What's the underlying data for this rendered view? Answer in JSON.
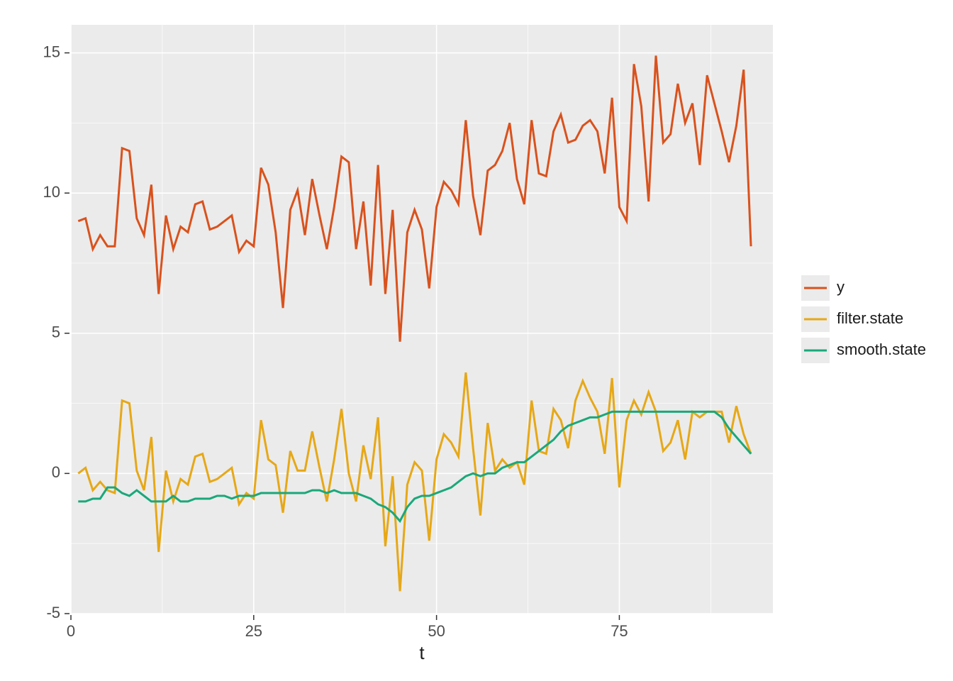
{
  "chart_data": {
    "type": "line",
    "xlabel": "t",
    "ylabel": "",
    "title": "",
    "xlim": [
      0,
      96
    ],
    "ylim": [
      -5,
      16
    ],
    "x_ticks": [
      0,
      25,
      50,
      75
    ],
    "y_ticks": [
      -5,
      0,
      5,
      10,
      15
    ],
    "grid": true,
    "legend_position": "right",
    "x": [
      1,
      2,
      3,
      4,
      5,
      6,
      7,
      8,
      9,
      10,
      11,
      12,
      13,
      14,
      15,
      16,
      17,
      18,
      19,
      20,
      21,
      22,
      23,
      24,
      25,
      26,
      27,
      28,
      29,
      30,
      31,
      32,
      33,
      34,
      35,
      36,
      37,
      38,
      39,
      40,
      41,
      42,
      43,
      44,
      45,
      46,
      47,
      48,
      49,
      50,
      51,
      52,
      53,
      54,
      55,
      56,
      57,
      58,
      59,
      60,
      61,
      62,
      63,
      64,
      65,
      66,
      67,
      68,
      69,
      70,
      71,
      72,
      73,
      74,
      75,
      76,
      77,
      78,
      79,
      80,
      81,
      82,
      83,
      84,
      85,
      86,
      87,
      88,
      89,
      90,
      91,
      92,
      93
    ],
    "series": [
      {
        "name": "y",
        "color": "#d9521d",
        "values": [
          9.0,
          9.1,
          8.0,
          8.5,
          8.1,
          8.1,
          11.6,
          11.5,
          9.1,
          8.5,
          10.3,
          6.4,
          9.2,
          8.0,
          8.8,
          8.6,
          9.6,
          9.7,
          8.7,
          8.8,
          9.0,
          9.2,
          7.9,
          8.3,
          8.1,
          10.9,
          10.3,
          8.6,
          5.9,
          9.4,
          10.1,
          8.5,
          10.5,
          9.2,
          8.0,
          9.5,
          11.3,
          11.1,
          8.0,
          9.7,
          6.7,
          11.0,
          6.4,
          9.4,
          4.7,
          8.6,
          9.4,
          8.7,
          6.6,
          9.5,
          10.4,
          10.1,
          9.6,
          12.6,
          9.9,
          8.5,
          10.8,
          11.0,
          11.5,
          12.5,
          10.5,
          9.6,
          12.6,
          10.7,
          10.6,
          12.2,
          12.8,
          11.8,
          11.9,
          12.4,
          12.6,
          12.2,
          10.7,
          13.4,
          9.5,
          9.0,
          14.6,
          13.1,
          9.7,
          14.9,
          11.8,
          12.1,
          13.9,
          12.5,
          13.2,
          11.0,
          14.2,
          13.2,
          12.2,
          11.1,
          12.4,
          14.4,
          8.1
        ]
      },
      {
        "name": "filter.state",
        "color": "#e6a817",
        "values": [
          0.0,
          0.2,
          -0.6,
          -0.3,
          -0.6,
          -0.7,
          2.6,
          2.5,
          0.1,
          -0.6,
          1.3,
          -2.8,
          0.1,
          -1.0,
          -0.2,
          -0.4,
          0.6,
          0.7,
          -0.3,
          -0.2,
          0.0,
          0.2,
          -1.1,
          -0.7,
          -0.9,
          1.9,
          0.5,
          0.3,
          -1.4,
          0.8,
          0.1,
          0.1,
          1.5,
          0.2,
          -1.0,
          0.5,
          2.3,
          0.0,
          -1.0,
          1.0,
          -0.2,
          2.0,
          -2.6,
          -0.1,
          -4.2,
          -0.4,
          0.4,
          0.1,
          -2.4,
          0.5,
          1.4,
          1.1,
          0.6,
          3.6,
          0.9,
          -1.5,
          1.8,
          0.1,
          0.5,
          0.2,
          0.4,
          -0.4,
          2.6,
          0.8,
          0.7,
          2.3,
          1.9,
          0.9,
          2.6,
          3.3,
          2.7,
          2.2,
          0.7,
          3.4,
          -0.5,
          1.9,
          2.6,
          2.1,
          2.9,
          2.2,
          0.8,
          1.1,
          1.9,
          0.5,
          2.2,
          2.0,
          2.2,
          2.2,
          2.2,
          1.1,
          2.4,
          1.4,
          0.7
        ]
      },
      {
        "name": "smooth.state",
        "color": "#1aa87a",
        "values": [
          -1.0,
          -1.0,
          -0.9,
          -0.9,
          -0.5,
          -0.5,
          -0.7,
          -0.8,
          -0.6,
          -0.8,
          -1.0,
          -1.0,
          -1.0,
          -0.8,
          -1.0,
          -1.0,
          -0.9,
          -0.9,
          -0.9,
          -0.8,
          -0.8,
          -0.9,
          -0.8,
          -0.8,
          -0.8,
          -0.7,
          -0.7,
          -0.7,
          -0.7,
          -0.7,
          -0.7,
          -0.7,
          -0.6,
          -0.6,
          -0.7,
          -0.6,
          -0.7,
          -0.7,
          -0.7,
          -0.8,
          -0.9,
          -1.1,
          -1.2,
          -1.4,
          -1.7,
          -1.2,
          -0.9,
          -0.8,
          -0.8,
          -0.7,
          -0.6,
          -0.5,
          -0.3,
          -0.1,
          0.0,
          -0.1,
          0.0,
          0.0,
          0.2,
          0.3,
          0.4,
          0.4,
          0.6,
          0.8,
          1.0,
          1.2,
          1.5,
          1.7,
          1.8,
          1.9,
          2.0,
          2.0,
          2.1,
          2.2,
          2.2,
          2.2,
          2.2,
          2.2,
          2.2,
          2.2,
          2.2,
          2.2,
          2.2,
          2.2,
          2.2,
          2.2,
          2.2,
          2.2,
          2.0,
          1.6,
          1.3,
          1.0,
          0.7
        ]
      }
    ]
  }
}
